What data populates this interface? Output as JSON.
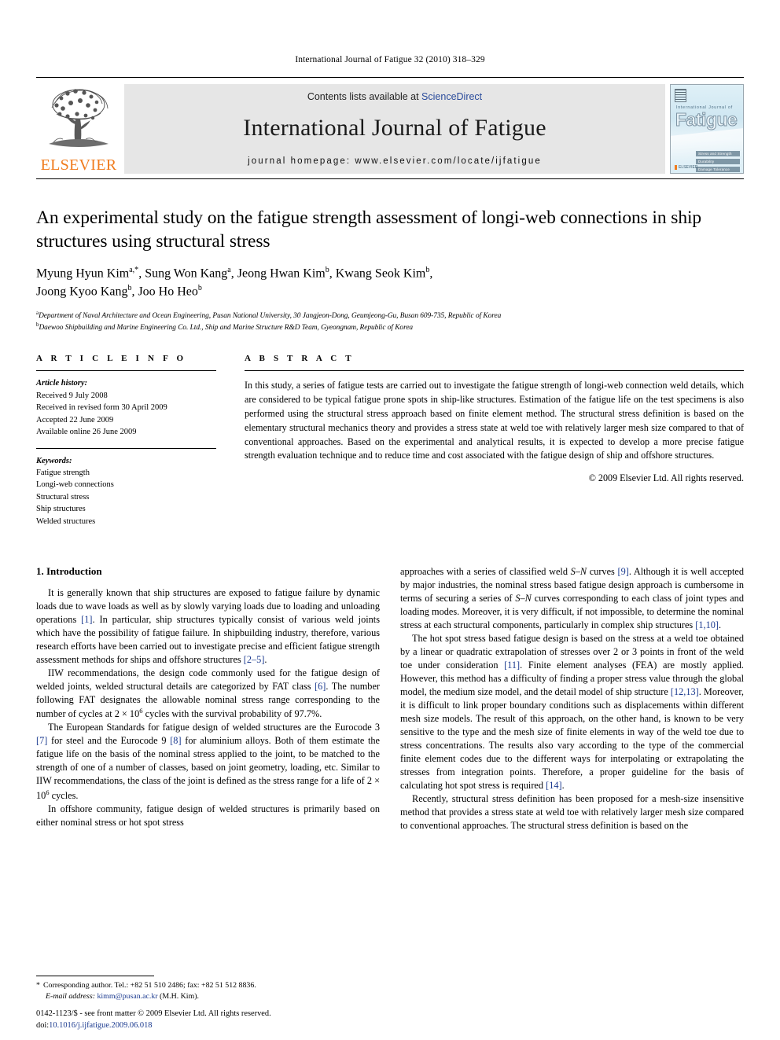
{
  "running_head": "International Journal of Fatigue 32 (2010) 318–329",
  "masthead": {
    "publisher_logo_label": "ELSEVIER",
    "contents_prefix": "Contents lists available at ",
    "contents_link": "ScienceDirect",
    "journal_name": "International Journal of Fatigue",
    "homepage": "journal homepage: www.elsevier.com/locate/ijfatigue",
    "cover": {
      "small_title": "International Journal of",
      "big_title": "Fatigue",
      "bars": [
        "Stress and Strength",
        "Durability",
        "Damage Tolerance"
      ],
      "footer_label": "ELSEVIER"
    }
  },
  "article": {
    "title": "An experimental study on the fatigue strength assessment of longi-web connections in ship structures using structural stress",
    "authors_line1": "Myung Hyun Kim a,*, Sung Won Kang a, Jeong Hwan Kim b, Kwang Seok Kim b,",
    "authors_line2": "Joong Kyoo Kang b, Joo Ho Heo b",
    "affiliations": [
      {
        "marker": "a",
        "text": "Department of Naval Architecture and Ocean Engineering, Pusan National University, 30 Jangjeon-Dong, Geumjeong-Gu, Busan 609-735, Republic of Korea"
      },
      {
        "marker": "b",
        "text": "Daewoo Shipbuilding and Marine Engineering Co. Ltd., Ship and Marine Structure R&D Team, Gyeongnam, Republic of Korea"
      }
    ]
  },
  "article_info": {
    "heading": "A R T I C L E    I N F O",
    "history_label": "Article history:",
    "history": [
      "Received 9 July 2008",
      "Received in revised form 30 April 2009",
      "Accepted 22 June 2009",
      "Available online 26 June 2009"
    ],
    "keywords_label": "Keywords:",
    "keywords": [
      "Fatigue strength",
      "Longi-web connections",
      "Structural stress",
      "Ship structures",
      "Welded structures"
    ]
  },
  "abstract": {
    "heading": "A B S T R A C T",
    "text": "In this study, a series of fatigue tests are carried out to investigate the fatigue strength of longi-web connection weld details, which are considered to be typical fatigue prone spots in ship-like structures. Estimation of the fatigue life on the test specimens is also performed using the structural stress approach based on finite element method. The structural stress definition is based on the elementary structural mechanics theory and provides a stress state at weld toe with relatively larger mesh size compared to that of conventional approaches. Based on the experimental and analytical results, it is expected to develop a more precise fatigue strength evaluation technique and to reduce time and cost associated with the fatigue design of ship and offshore structures.",
    "copyright": "© 2009 Elsevier Ltd. All rights reserved."
  },
  "body": {
    "section_number_title": "1. Introduction",
    "left_paragraphs": [
      "It is generally known that ship structures are exposed to fatigue failure by dynamic loads due to wave loads as well as by slowly varying loads due to loading and unloading operations [1]. In particular, ship structures typically consist of various weld joints which have the possibility of fatigue failure. In shipbuilding industry, therefore, various research efforts have been carried out to investigate precise and efficient fatigue strength assessment methods for ships and offshore structures [2–5].",
      "IIW recommendations, the design code commonly used for the fatigue design of welded joints, welded structural details are categorized by FAT class [6]. The number following FAT designates the allowable nominal stress range corresponding to the number of cycles at 2 × 10⁶ cycles with the survival probability of 97.7%.",
      "The European Standards for fatigue design of welded structures are the Eurocode 3 [7] for steel and the Eurocode 9 [8] for aluminium alloys. Both of them estimate the fatigue life on the basis of the nominal stress applied to the joint, to be matched to the strength of one of a number of classes, based on joint geometry, loading, etc. Similar to IIW recommendations, the class of the joint is defined as the stress range for a life of 2 × 10⁶ cycles.",
      "In offshore community, fatigue design of welded structures is primarily based on either nominal stress or hot spot stress"
    ],
    "right_paragraphs": [
      "approaches with a series of classified weld S–N curves [9]. Although it is well accepted by major industries, the nominal stress based fatigue design approach is cumbersome in terms of securing a series of S–N curves corresponding to each class of joint types and loading modes. Moreover, it is very difficult, if not impossible, to determine the nominal stress at each structural components, particularly in complex ship structures [1,10].",
      "The hot spot stress based fatigue design is based on the stress at a weld toe obtained by a linear or quadratic extrapolation of stresses over 2 or 3 points in front of the weld toe under consideration [11]. Finite element analyses (FEA) are mostly applied. However, this method has a difficulty of finding a proper stress value through the global model, the medium size model, and the detail model of ship structure [12,13]. Moreover, it is difficult to link proper boundary conditions such as displacements within different mesh size models. The result of this approach, on the other hand, is known to be very sensitive to the type and the mesh size of finite elements in way of the weld toe due to stress concentrations. The results also vary according to the type of the commercial finite element codes due to the different ways for interpolating or extrapolating the stresses from integration points. Therefore, a proper guideline for the basis of calculating hot spot stress is required [14].",
      "Recently, structural stress definition has been proposed for a mesh-size insensitive method that provides a stress state at weld toe with relatively larger mesh size compared to conventional approaches. The structural stress definition is based on the"
    ]
  },
  "footnote": {
    "symbol": "*",
    "text_before_mail": "Corresponding author. Tel.: +82 51 510 2486; fax: +82 51 512 8836.",
    "email_label": "E-mail address:",
    "email": "kimm@pusan.ac.kr",
    "email_suffix": "(M.H. Kim)."
  },
  "page_footer": {
    "issn_line": "0142-1123/$ - see front matter © 2009 Elsevier Ltd. All rights reserved.",
    "doi_label": "doi:",
    "doi_value": "10.1016/j.ijfatigue.2009.06.018"
  },
  "colors": {
    "link_blue": "#1b3a8f",
    "sciencedirect_blue": "#2a4b9b",
    "elsevier_orange": "#f07c1e",
    "banner_gray": "#e6e6e6"
  }
}
